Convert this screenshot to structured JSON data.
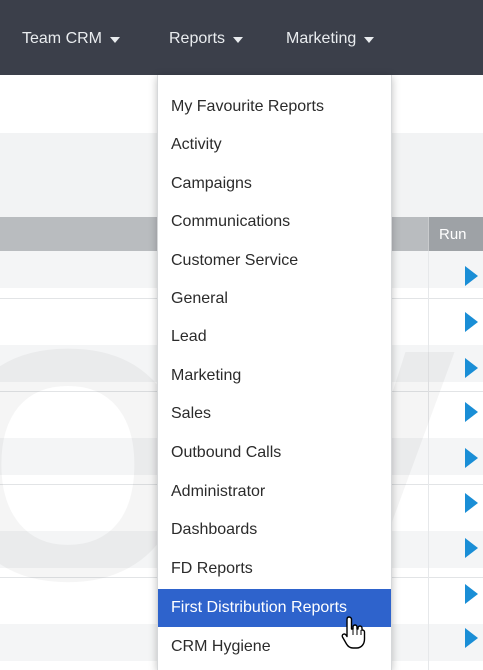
{
  "nav": {
    "items": [
      "Team CRM",
      "Reports",
      "Marketing"
    ]
  },
  "table": {
    "run_header": "Run"
  },
  "watermark": "OVE",
  "dropdown": {
    "items": [
      "My Favourite Reports",
      "Activity",
      "Campaigns",
      "Communications",
      "Customer Service",
      "General",
      "Lead",
      "Marketing",
      "Sales",
      "Outbound Calls",
      "Administrator",
      "Dashboards",
      "FD Reports",
      "First Distribution Reports",
      "CRM Hygiene"
    ],
    "active_item": "First Distribution Reports"
  },
  "colors": {
    "topbar": "#3b3f4a",
    "accent_highlight": "#2e63cc",
    "run_icon": "#1a8ed6"
  },
  "icons": {
    "nav_caret": "caret-down-icon",
    "run": "play-icon",
    "cursor": "hand-pointer-icon"
  }
}
